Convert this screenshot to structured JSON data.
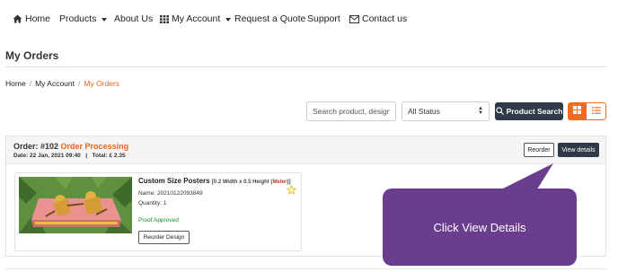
{
  "nav": {
    "home": "Home",
    "products": "Products",
    "about": "About Us",
    "my_account": "My Account",
    "quote": "Request a Quote",
    "support": "Support",
    "contact": "Contact us"
  },
  "page": {
    "title": "My Orders"
  },
  "breadcrumb": {
    "home": "Home",
    "account": "My Account",
    "current": "My Orders",
    "separator": "/"
  },
  "filters": {
    "search_placeholder": "Search product, design, o",
    "status_value": "All Status",
    "search_button": "Product Search"
  },
  "order": {
    "label": "Order: #102",
    "status": "Order Processing",
    "date": "Date: 22 Jan, 2021 09:40",
    "divider": "|",
    "total": "Total: £ 2.35",
    "reorder_button": "Reorder",
    "view_button": "View details",
    "item": {
      "name": "Custom Size Posters",
      "size": "[0.2 Width x 0.5 Height (",
      "unit": "Meter",
      "size_end": ")]",
      "name_line": "Name: 20210122093849",
      "quantity_line": "Quantity: 1",
      "proof_status": "Proof Approved",
      "reorder_design_button": "Reorder Design"
    }
  },
  "callout": {
    "text": "Click View Details"
  },
  "colors": {
    "accent_orange": "#e8661c",
    "dark_button": "#2e3a47",
    "callout_purple": "#6a3d8f",
    "proof_green": "#1a8e2e"
  },
  "icons": {
    "home": "home-icon",
    "account": "grid-icon",
    "contact": "envelope-icon",
    "search": "search-icon",
    "grid_view": "grid-view-icon",
    "list_view": "list-view-icon",
    "favorite": "star-icon"
  }
}
